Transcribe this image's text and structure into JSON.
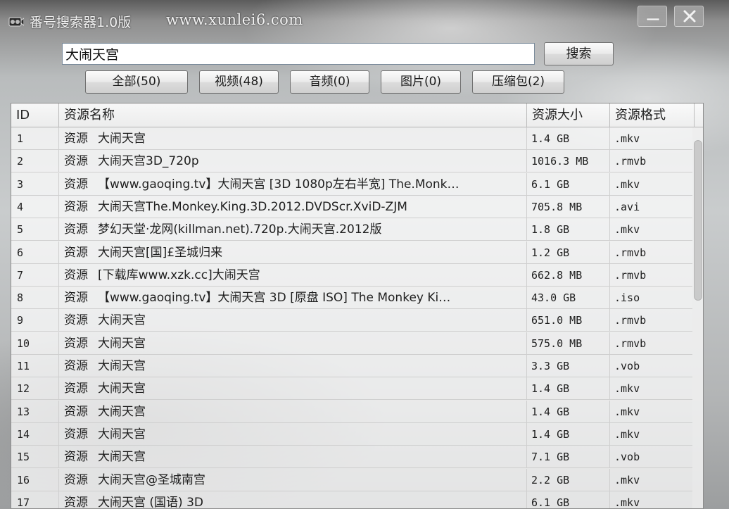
{
  "window": {
    "title": "番号搜索器1.0版",
    "url": "www.xunlei6.com"
  },
  "search": {
    "value": "大闹天宫",
    "button_label": "搜索"
  },
  "filters": [
    {
      "label": "全部(50)"
    },
    {
      "label": "视频(48)"
    },
    {
      "label": "音频(0)"
    },
    {
      "label": "图片(0)"
    },
    {
      "label": "压缩包(2)"
    }
  ],
  "table": {
    "columns": [
      "ID",
      "资源名称",
      "资源大小",
      "资源格式"
    ],
    "tag": "资源",
    "rows": [
      {
        "id": "1",
        "name": "大闹天宫",
        "size": "1.4 GB",
        "format": ".mkv"
      },
      {
        "id": "2",
        "name": "大闹天宫3D_720p",
        "size": "1016.3 MB",
        "format": ".rmvb"
      },
      {
        "id": "3",
        "name": "【www.gaoqing.tv】大闹天宫 [3D 1080p左右半宽] The.Monk…",
        "size": "6.1 GB",
        "format": ".mkv"
      },
      {
        "id": "4",
        "name": "大闹天宫The.Monkey.King.3D.2012.DVDScr.XviD-ZJM",
        "size": "705.8 MB",
        "format": ".avi"
      },
      {
        "id": "5",
        "name": "梦幻天堂·龙网(killman.net).720p.大闹天宫.2012版",
        "size": "1.8 GB",
        "format": ".mkv"
      },
      {
        "id": "6",
        "name": "大闹天宫[国]£圣城归来",
        "size": "1.2 GB",
        "format": ".rmvb"
      },
      {
        "id": "7",
        "name": "[下载库www.xzk.cc]大闹天宫",
        "size": "662.8 MB",
        "format": ".rmvb"
      },
      {
        "id": "8",
        "name": "【www.gaoqing.tv】大闹天宫 3D [原盘 ISO] The Monkey Ki…",
        "size": "43.0 GB",
        "format": ".iso"
      },
      {
        "id": "9",
        "name": "大闹天宫",
        "size": "651.0 MB",
        "format": ".rmvb"
      },
      {
        "id": "10",
        "name": "大闹天宫",
        "size": "575.0 MB",
        "format": ".rmvb"
      },
      {
        "id": "11",
        "name": "大闹天宫",
        "size": "3.3 GB",
        "format": ".vob"
      },
      {
        "id": "12",
        "name": "大闹天宫",
        "size": "1.4 GB",
        "format": ".mkv"
      },
      {
        "id": "13",
        "name": "大闹天宫",
        "size": "1.4 GB",
        "format": ".mkv"
      },
      {
        "id": "14",
        "name": "大闹天宫",
        "size": "1.4 GB",
        "format": ".mkv"
      },
      {
        "id": "15",
        "name": "大闹天宫",
        "size": "7.1 GB",
        "format": ".vob"
      },
      {
        "id": "16",
        "name": "大闹天宫@圣城南宫",
        "size": "2.2 GB",
        "format": ".mkv"
      },
      {
        "id": "17",
        "name": "大闹天宫 (国语) 3D",
        "size": "6.1 GB",
        "format": ".mkv"
      }
    ]
  },
  "icons": {
    "app": "film-reel-icon",
    "minimize": "minimize-icon",
    "close": "close-icon"
  }
}
